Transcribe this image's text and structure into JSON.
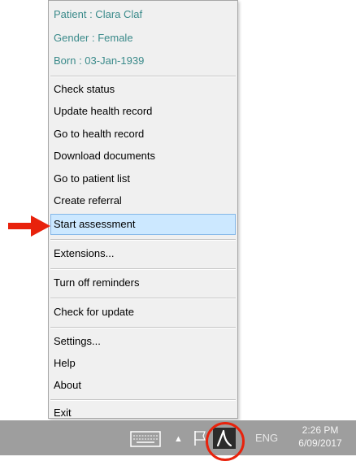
{
  "patient": {
    "name_line": "Patient : Clara Claf",
    "gender_line": "Gender : Female",
    "born_line": "Born : 03-Jan-1939"
  },
  "menu": {
    "check_status": "Check status",
    "update_health_record": "Update health record",
    "go_to_health_record": "Go to health record",
    "download_documents": "Download documents",
    "go_to_patient_list": "Go to patient list",
    "create_referral": "Create referral",
    "start_assessment": "Start assessment",
    "extensions": "Extensions...",
    "turn_off_reminders": "Turn off reminders",
    "check_for_update": "Check for update",
    "settings": "Settings...",
    "help": "Help",
    "about": "About",
    "exit": "Exit"
  },
  "taskbar": {
    "language": "ENG",
    "time": "2:26 PM",
    "date": "6/09/2017",
    "icons": [
      "keyboard-icon",
      "chevron-up-icon",
      "flag-icon",
      "app-tray-icon"
    ]
  },
  "colors": {
    "info_text": "#3a8a8a",
    "selection_bg": "#cce8ff",
    "selection_border": "#84b7e8",
    "annotation_red": "#e8220c",
    "taskbar_bg": "#9e9e9e"
  }
}
